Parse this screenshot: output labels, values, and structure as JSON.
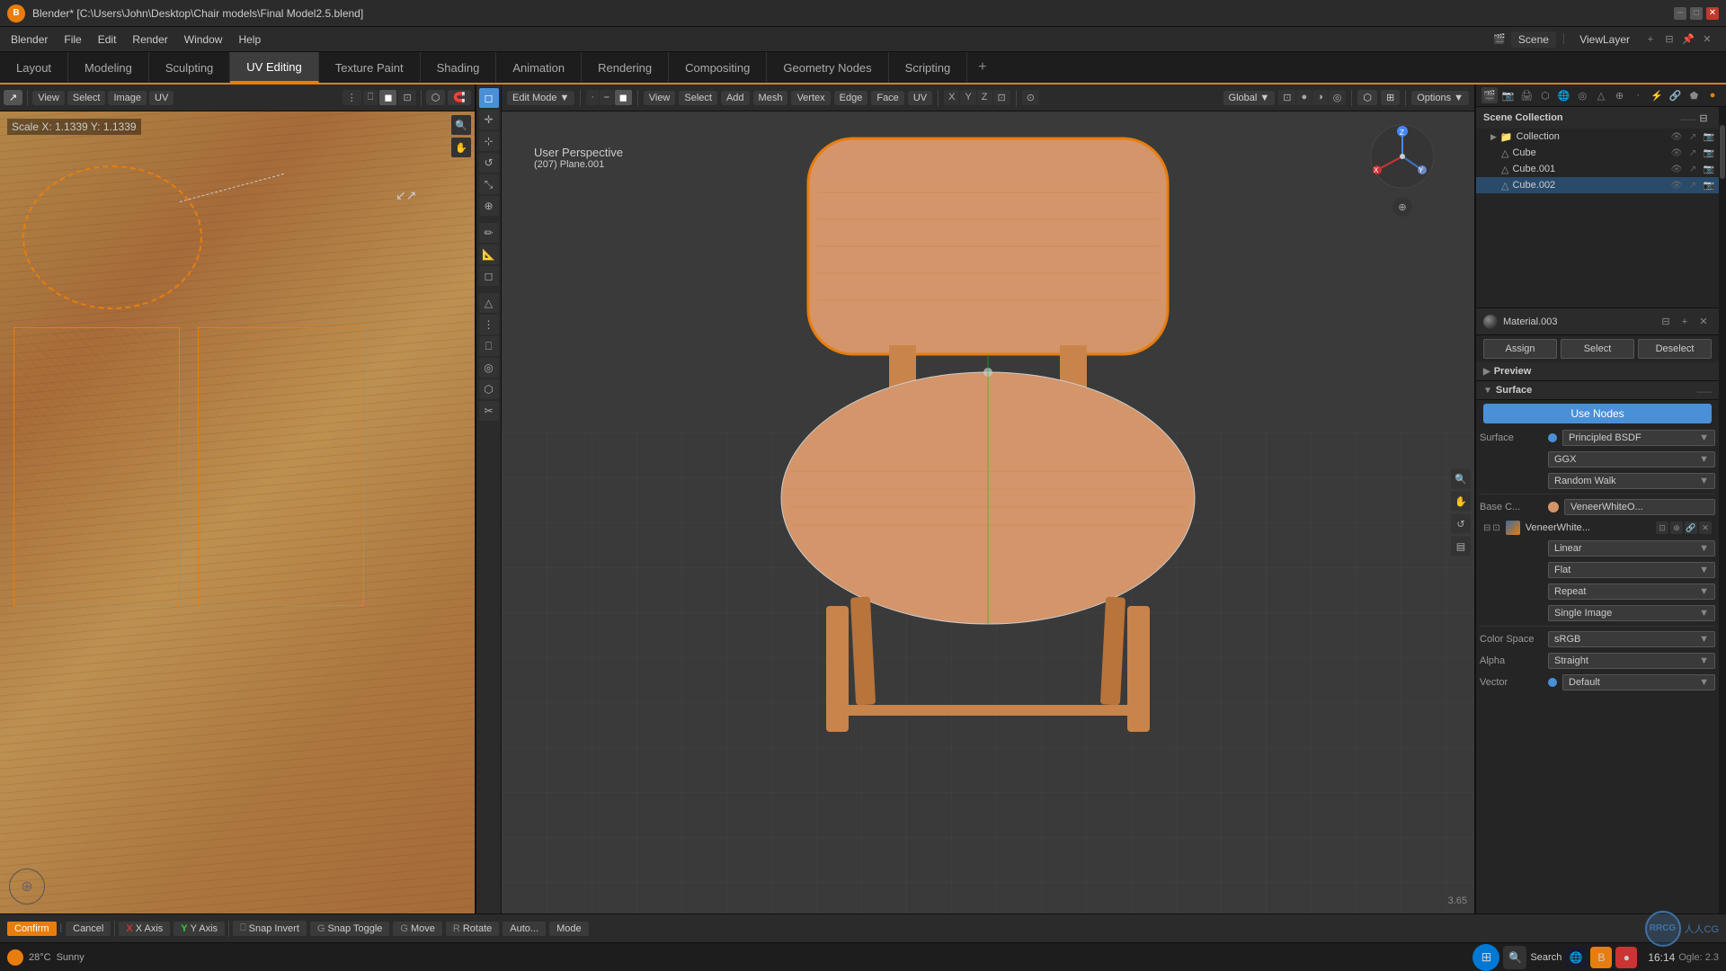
{
  "window": {
    "title": "Blender* [C:\\Users\\John\\Desktop\\Chair models\\Final Model2.5.blend]",
    "app_name": "Blender",
    "version": "3.65"
  },
  "menubar": {
    "items": [
      "Blender",
      "File",
      "Edit",
      "Render",
      "Window",
      "Help"
    ]
  },
  "tabs": {
    "items": [
      "Layout",
      "Modeling",
      "Sculpting",
      "UV Editing",
      "Texture Paint",
      "Shading",
      "Animation",
      "Rendering",
      "Compositing",
      "Geometry Nodes",
      "Scripting"
    ],
    "active": "UV Editing",
    "add_label": "+"
  },
  "top_right": {
    "scene_label": "Scene",
    "view_layer_label": "ViewLayer"
  },
  "uv_editor": {
    "scale_text": "Scale X: 1.1339  Y: 1.1339",
    "perspective_label": "User Perspective",
    "object_label": "(207) Plane.001"
  },
  "viewport_header": {
    "mode": "Edit Mode",
    "mode_icon": "▼",
    "view": "View",
    "select": "Select",
    "add": "Add",
    "mesh": "Mesh",
    "vertex": "Vertex",
    "edge": "Edge",
    "face": "Face",
    "uv": "UV",
    "shading_label": "Global",
    "options": "Options",
    "options_arrow": "▼"
  },
  "viewport_3d": {
    "perspective_label": "User Perspective",
    "object_info": "(207) Plane.001",
    "overlay_btns": [
      "X",
      "Y",
      "Z"
    ]
  },
  "right_panel": {
    "header_icons": [
      "🔍"
    ],
    "search_placeholder": "",
    "scene_collection": "Scene Collection",
    "collection_name": "Collection",
    "objects": [
      {
        "name": "Cube",
        "type": "mesh"
      },
      {
        "name": "Cube.001",
        "type": "mesh"
      },
      {
        "name": "Cube.002",
        "type": "mesh"
      }
    ]
  },
  "properties": {
    "breadcrumb_object": "Plane.001",
    "breadcrumb_sep": "▶",
    "breadcrumb_material": "Material.003",
    "material_name": "Material.003",
    "material_dot_color": "#888888",
    "assign_label": "Assign",
    "select_label": "Select",
    "deselect_label": "Deselect",
    "preview_section": "Preview",
    "surface_section": "Surface",
    "use_nodes_label": "Use Nodes",
    "surface_label": "Surface",
    "surface_value": "Principled BSDF",
    "ggx_label": "GGX",
    "random_walk_label": "Random Walk",
    "random_walk_arrow": "▼",
    "base_color_label": "Base C...",
    "base_color_value": "VeneerWhiteO...",
    "base_color_dot": "#d4956a",
    "texture_name": "VeneerWhite...",
    "linear_label": "Linear",
    "linear_arrow": "▼",
    "flat_label": "Flat",
    "flat_arrow": "▼",
    "repeat_label": "Repeat",
    "repeat_arrow": "▼",
    "single_image_label": "Single Image",
    "single_image_arrow": "▼",
    "color_space_label": "Color Space",
    "color_space_value": "sRGB",
    "color_space_arrow": "▼",
    "alpha_label": "Alpha",
    "alpha_value": "Straight",
    "alpha_arrow": "▼",
    "vector_label": "Vector",
    "vector_value": "Default",
    "vector_dot": "#4a90d9"
  },
  "status_bar": {
    "temp": "28°C",
    "weather": "Sunny",
    "weather_icon": "☀"
  },
  "bottom_toolbar": {
    "confirm_label": "Confirm",
    "cancel_label": "Cancel",
    "x_axis_label": "X Axis",
    "y_axis_label": "Y Axis",
    "snap_invert_label": "Snap Invert",
    "snap_toggle_label": "Snap Toggle",
    "move_label": "Move",
    "rotate_label": "Rotate",
    "auto_label": "Auto...",
    "mode_label": "Mode"
  },
  "icons": {
    "cursor": "✛",
    "move": "⊹",
    "rotate": "↺",
    "scale": "⤡",
    "transform": "⊕",
    "annotate": "✏",
    "measure": "📐",
    "add_cube": "◻",
    "select_box": "◻",
    "mesh_icon": "△",
    "sphere_icon": "●",
    "torus_icon": "◎",
    "bone_icon": "⊘",
    "camera_icon": "📷",
    "light_icon": "💡",
    "material_icon": "●",
    "search_icon": "🔍",
    "eye_icon": "👁",
    "layer_icon": "⬡",
    "filter_icon": "⊟"
  }
}
